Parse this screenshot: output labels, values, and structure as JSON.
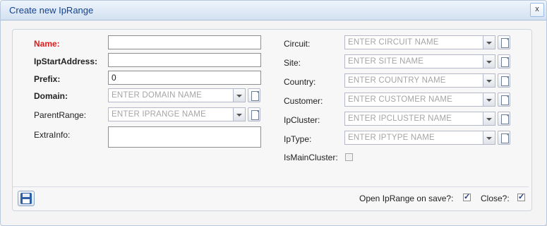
{
  "window": {
    "title": "Create new IpRange",
    "close_label": "x"
  },
  "left_fields": {
    "name": {
      "label": "Name:",
      "value": ""
    },
    "ip_start": {
      "label": "IpStartAddress:",
      "value": ""
    },
    "prefix": {
      "label": "Prefix:",
      "value": "0"
    },
    "domain": {
      "label": "Domain:",
      "placeholder": "ENTER DOMAIN NAME"
    },
    "parent_range": {
      "label": "ParentRange:",
      "placeholder": "ENTER IPRANGE NAME"
    },
    "extra_info": {
      "label": "ExtraInfo:",
      "value": ""
    }
  },
  "right_fields": {
    "circuit": {
      "label": "Circuit:",
      "placeholder": "ENTER CIRCUIT NAME"
    },
    "site": {
      "label": "Site:",
      "placeholder": "ENTER SITE NAME"
    },
    "country": {
      "label": "Country:",
      "placeholder": "ENTER COUNTRY NAME"
    },
    "customer": {
      "label": "Customer:",
      "placeholder": "ENTER CUSTOMER NAME"
    },
    "ip_cluster": {
      "label": "IpCluster:",
      "placeholder": "ENTER IPCLUSTER NAME"
    },
    "ip_type": {
      "label": "IpType:",
      "placeholder": "ENTER IPTYPE NAME"
    },
    "is_main_cluster": {
      "label": "IsMainCluster:",
      "checked": false
    }
  },
  "footer": {
    "open_on_save": {
      "label": "Open IpRange on save?:",
      "checked": true
    },
    "close": {
      "label": "Close?:",
      "checked": true
    }
  },
  "colors": {
    "required_label": "#e01b1b",
    "title_text": "#15428b",
    "placeholder": "#a5a5a5"
  }
}
